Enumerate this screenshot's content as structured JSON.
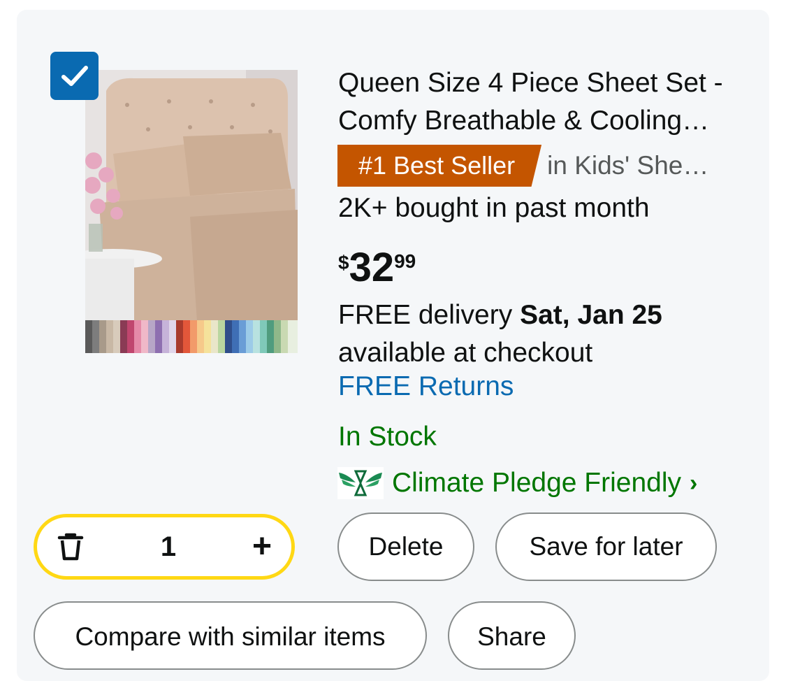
{
  "item": {
    "selected": true,
    "title_line1": "Queen Size 4 Piece Sheet Set -",
    "title_line2": "Comfy Breathable & Cooling…",
    "badge": "#1 Best Seller",
    "badge_category": "in Kids' She…",
    "bought": "2K+ bought in past month",
    "price": {
      "currency": "$",
      "whole": "32",
      "fraction": "99"
    },
    "delivery_prefix": "FREE delivery ",
    "delivery_date": "Sat, Jan 25",
    "delivery_note": "available at checkout",
    "returns": "FREE Returns",
    "stock": "In Stock",
    "climate": "Climate Pledge Friendly",
    "quantity": "1"
  },
  "actions": {
    "delete": "Delete",
    "save_for_later": "Save for later",
    "compare": "Compare with similar items",
    "share": "Share"
  },
  "colors": {
    "badge": "#c45500",
    "link": "#0a6ab1",
    "in_stock": "#007600",
    "qty_border": "#ffd814",
    "checkbox": "#0a6ab1"
  },
  "icons": [
    "checkmark-icon",
    "trash-icon",
    "plus-icon",
    "climate-pledge-icon",
    "chevron-right-icon"
  ]
}
